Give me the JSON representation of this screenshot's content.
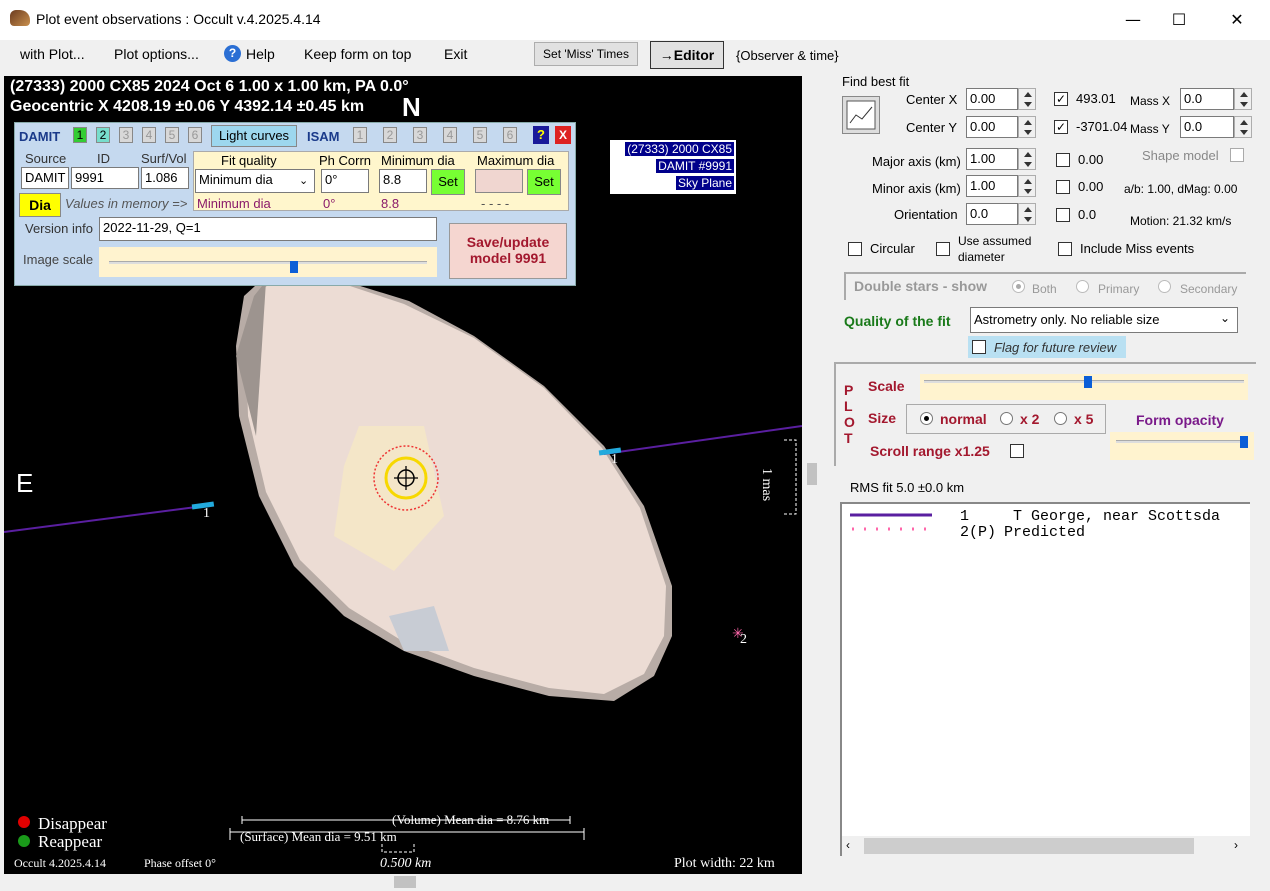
{
  "window": {
    "title": "Plot event observations : Occult v.4.2025.4.14",
    "min": "—",
    "max": "☐",
    "close": "✕"
  },
  "menu": {
    "with_plot": "with Plot...",
    "plot_options": "Plot options...",
    "help": "Help",
    "keep_on_top": "Keep form on top",
    "exit": "Exit",
    "set_miss": "Set 'Miss' Times",
    "editor": "→Editor",
    "observer_time": "{Observer & time}"
  },
  "plot": {
    "header1": "(27333) 2000 CX85  2024 Oct 6  1.00 x 1.00 km, PA 0.0°",
    "header2": "Geocentric  X  4208.19 ±0.06  Y 4392.14 ±0.45 km",
    "north": "N",
    "east": "E",
    "info_box": [
      "(27333) 2000 CX85",
      "DAMIT #9991",
      "Sky Plane"
    ],
    "chord1_label": "1",
    "chord1b_label": "1",
    "chord2_label": "2",
    "scale_mas": "1 mas",
    "disappear": "Disappear",
    "reappear": "Reappear",
    "version": "Occult 4.2025.4.14",
    "phase_offset": "Phase offset 0°",
    "volume_dia": "(Volume) Mean dia = 8.76 km",
    "surface_dia": "(Surface) Mean dia = 9.51 km",
    "scale_km": "0.500 km",
    "plot_width": "Plot width: 22 km",
    "colors": {
      "chord": "#5a1fa0",
      "disappear": "#e00000",
      "reappear": "#1a9a1a",
      "shape": "#ecdcd4"
    }
  },
  "damit": {
    "damit_label": "DAMIT",
    "damit_tabs": [
      "1",
      "2",
      "3",
      "4",
      "5",
      "6"
    ],
    "light_curves": "Light curves",
    "isam_label": "ISAM",
    "isam_tabs": [
      "1",
      "2",
      "3",
      "4",
      "5",
      "6"
    ],
    "help": "?",
    "close": "X",
    "source_label": "Source",
    "id_label": "ID",
    "surf_vol_label": "Surf/Vol",
    "source_value": "DAMIT",
    "id_value": "9991",
    "surf_vol_value": "1.086",
    "fit_quality_label": "Fit quality",
    "fit_quality_value": "Minimum dia",
    "fit_quality_mem": "Minimum dia",
    "ph_corr_label": "Ph Corrn",
    "ph_corr_value": "0°",
    "ph_corr_mem": "0°",
    "min_dia_label": "Minimum dia",
    "min_dia_value": "8.8",
    "min_dia_mem": "8.8",
    "set": "Set",
    "max_dia_label": "Maximum dia",
    "max_dia_mem": "- - - -",
    "dia_button": "Dia",
    "values_in_memory": "Values in memory =>",
    "version_label": "Version info",
    "version_value": "2022-11-29, Q=1",
    "image_scale_label": "Image scale",
    "image_scale_value": 0.57,
    "save_button": "Save/update model 9991"
  },
  "fit": {
    "find_best_fit": "Find best fit",
    "center_x_label": "Center X",
    "center_x": "0.00",
    "center_y_label": "Center Y",
    "center_y": "0.00",
    "major_label": "Major axis (km)",
    "major": "1.00",
    "minor_label": "Minor axis (km)",
    "minor": "1.00",
    "orient_label": "Orientation",
    "orient": "0.0",
    "chk_493": "493.01",
    "chk_3701": "-3701.04",
    "mass_x_label": "Mass X",
    "mass_x": "0.0",
    "mass_y_label": "Mass Y",
    "mass_y": "0.0",
    "major_chk": "0.00",
    "minor_chk": "0.00",
    "orient_chk": "0.0",
    "shape_model": "Shape model",
    "ab_dmag": "a/b: 1.00, dMag: 0.00",
    "motion": "Motion: 21.32 km/s",
    "circular": "Circular",
    "use_assumed": "Use assumed",
    "diameter": "diameter",
    "include_miss": "Include Miss events",
    "double_stars": "Double stars - show",
    "both": "Both",
    "primary": "Primary",
    "secondary": "Secondary",
    "quality_label": "Quality of the fit",
    "quality_value": "Astrometry only. No reliable size",
    "flag_review": "Flag for future review"
  },
  "plotctl": {
    "plot_v": "PLOT",
    "scale": "Scale",
    "scale_value": 0.5,
    "size": "Size",
    "normal": "normal",
    "x2": "x 2",
    "x5": "x 5",
    "form_opacity": "Form opacity",
    "opacity_value": 0.95,
    "scroll_range": "Scroll range x1.25",
    "rms": "RMS fit 5.0 ±0.0 km"
  },
  "legend": {
    "rows": [
      {
        "num": "1",
        "name": "T George, near Scottsda"
      },
      {
        "num": "2(P)",
        "name": "Predicted"
      }
    ]
  }
}
